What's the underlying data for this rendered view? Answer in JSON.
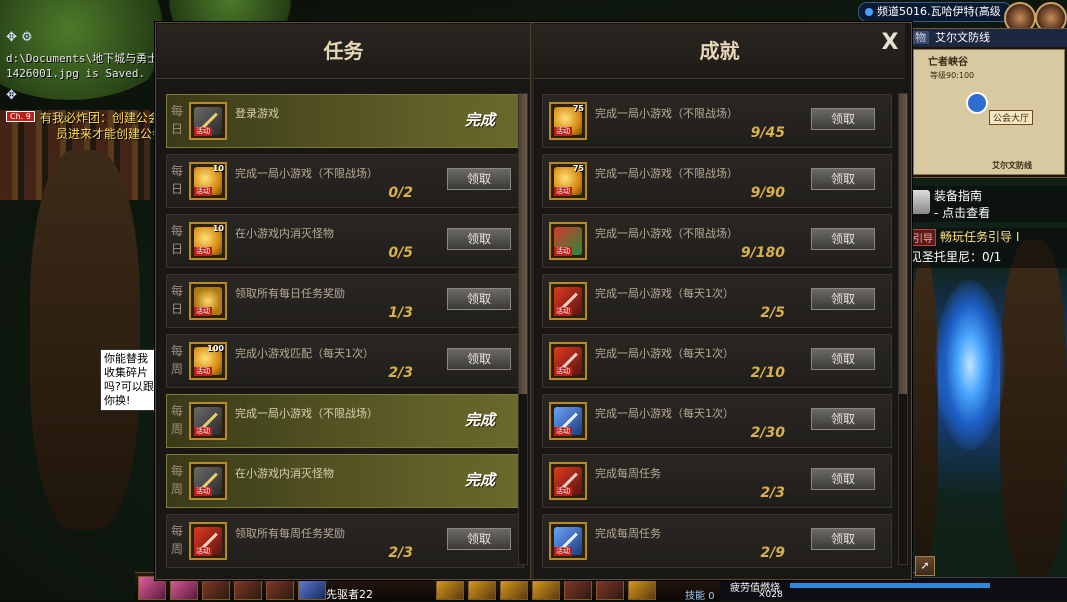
{
  "hud": {
    "save_path": "d:\\Documents\\地下城与勇士\\S",
    "save_msg": "1426001.jpg is Saved.",
    "chat_line1": "有我必炸团：创建公会",
    "chat_line2": "员进来才能创建公会",
    "channel_badge": "Ch. 9",
    "npc_bubble": "你能替我收集碎片吗?可以跟你换!",
    "channel_label": "频道5016.瓦哈伊特(高级",
    "minimap_tab": "物",
    "minimap_title": "艾尔文防线",
    "minimap_area": "亡者峡谷",
    "minimap_level": "等级90:100",
    "minimap_node": "公会大厅",
    "minimap_region": "艾尔文防线",
    "guide_title": "装备指南",
    "guide_sub": "- 点击查看",
    "quest_tag": "引导",
    "quest_title": "畅玩任务引导 I",
    "quest_progress": "见圣托里尼：0/1",
    "player_name": "先驱者22",
    "skill_label": "技能",
    "skill_count": "0",
    "fatigue_label": "疲劳值燃烧",
    "fatigue_count": "×028"
  },
  "dialog": {
    "left_title": "任务",
    "right_title": "成就",
    "close_label": "X",
    "claim_label": "领取",
    "done_label": "完成",
    "tasks": [
      {
        "period": "每日",
        "icon": "sword",
        "num": "",
        "desc": "登录游戏",
        "progress": "",
        "done": true
      },
      {
        "period": "每日",
        "icon": "gold",
        "num": "10",
        "desc": "完成一局小游戏（不限战场）",
        "progress": "0/2",
        "done": false
      },
      {
        "period": "每日",
        "icon": "gold",
        "num": "10",
        "desc": "在小游戏内消灭怪物",
        "progress": "0/5",
        "done": false
      },
      {
        "period": "每日",
        "icon": "hex",
        "num": "",
        "desc": "领取所有每日任务奖励",
        "progress": "1/3",
        "done": false
      },
      {
        "period": "每周",
        "icon": "gold",
        "num": "100",
        "desc": "完成小游戏匹配（每天1次）",
        "progress": "2/3",
        "done": false
      },
      {
        "period": "每周",
        "icon": "sword",
        "num": "",
        "desc": "完成一局小游戏（不限战场）",
        "progress": "",
        "done": true
      },
      {
        "period": "每周",
        "icon": "sword",
        "num": "",
        "desc": "在小游戏内消灭怪物",
        "progress": "",
        "done": true
      },
      {
        "period": "每周",
        "icon": "red",
        "num": "",
        "desc": "领取所有每周任务奖励",
        "progress": "2/3",
        "done": false
      }
    ],
    "achievements": [
      {
        "icon": "gold",
        "num": "75",
        "desc": "完成一局小游戏（不限战场）",
        "progress": "9/45"
      },
      {
        "icon": "gold",
        "num": "75",
        "desc": "完成一局小游戏（不限战场）",
        "progress": "9/90"
      },
      {
        "icon": "box",
        "num": "",
        "desc": "完成一局小游戏（不限战场）",
        "progress": "9/180"
      },
      {
        "icon": "red",
        "num": "",
        "desc": "完成一局小游戏（每天1次）",
        "progress": "2/5"
      },
      {
        "icon": "red",
        "num": "",
        "desc": "完成一局小游戏（每天1次）",
        "progress": "2/10"
      },
      {
        "icon": "blue",
        "num": "",
        "desc": "完成一局小游戏（每天1次）",
        "progress": "2/30"
      },
      {
        "icon": "red",
        "num": "",
        "desc": "完成每周任务",
        "progress": "2/3"
      },
      {
        "icon": "blue",
        "num": "",
        "desc": "完成每周任务",
        "progress": "2/9"
      }
    ],
    "icon_tag": "活动"
  },
  "colors": {
    "accent_gold": "#d9b04a",
    "done_row": "#5e5e28",
    "panel_bg": "#191714"
  }
}
